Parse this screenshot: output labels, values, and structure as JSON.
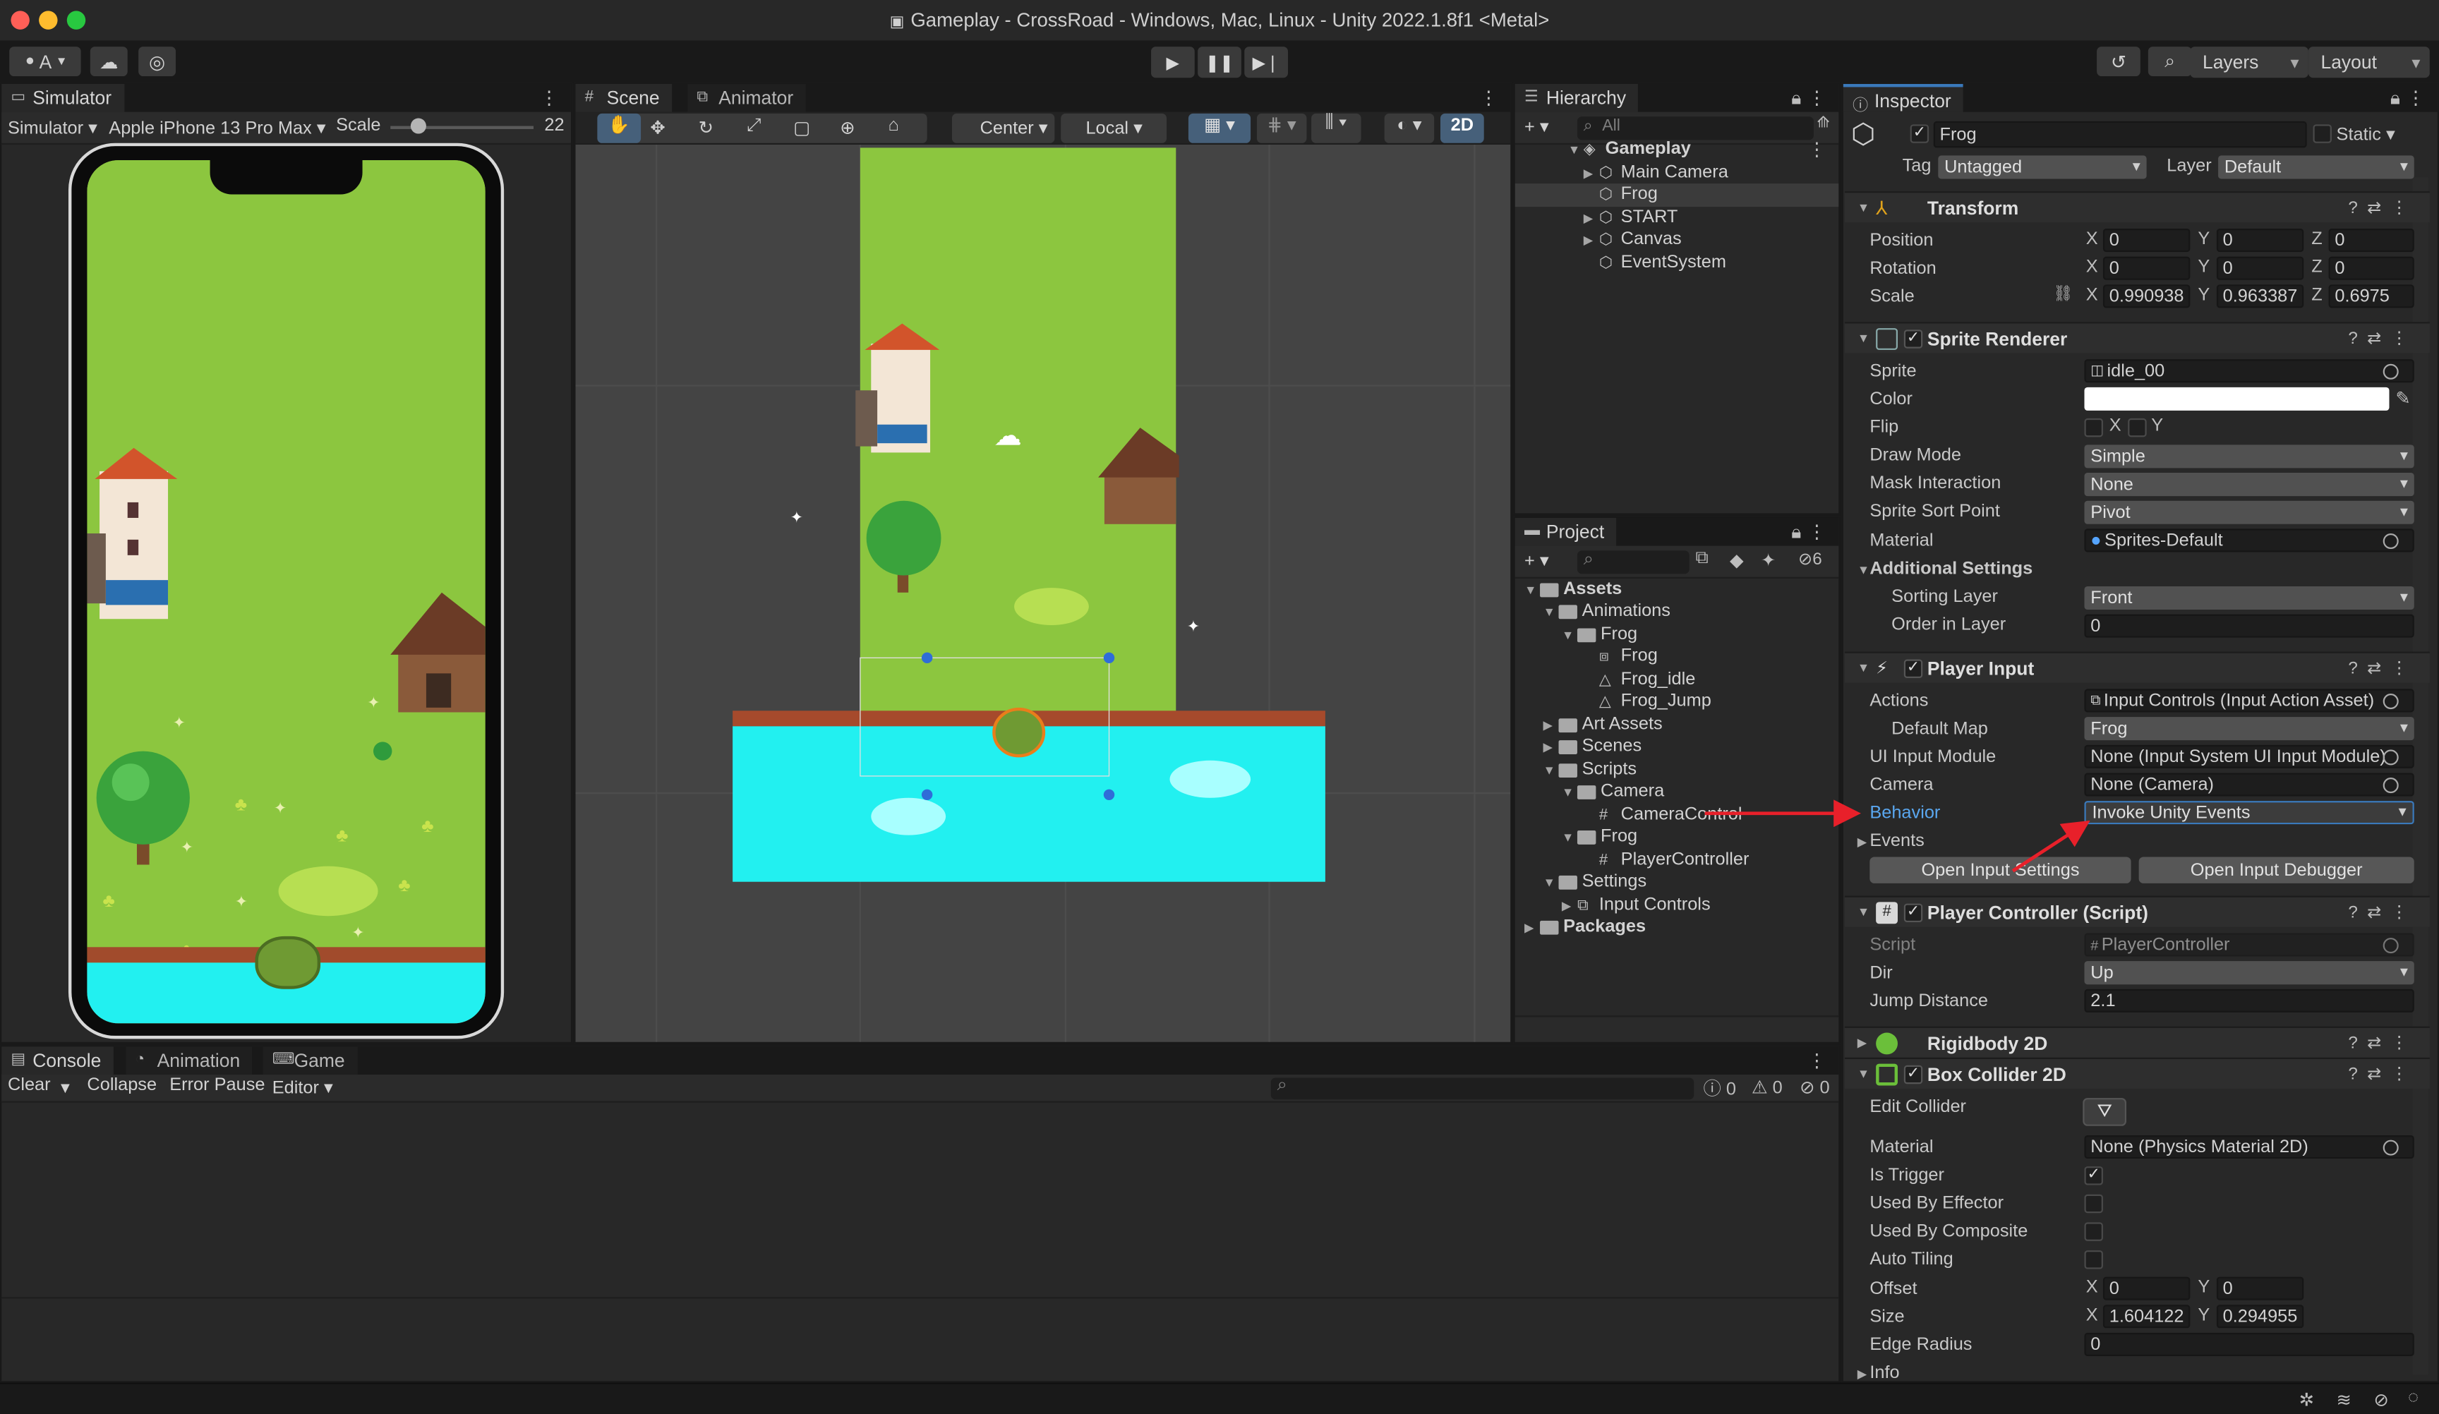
{
  "window": {
    "title": "Gameplay - CrossRoad - Windows, Mac, Linux - Unity 2022.1.8f1 <Metal>"
  },
  "toolbar": {
    "account": "A",
    "layers": "Layers",
    "layout": "Layout"
  },
  "simulator": {
    "tab": "Simulator",
    "mode": "Simulator",
    "device": "Apple iPhone 13 Pro Max",
    "scale_label": "Scale",
    "scale_value": "22",
    "scale_fraction": 0.2
  },
  "scene": {
    "tab": "Scene",
    "animator_tab": "Animator",
    "pivot": "Center",
    "space": "Local",
    "mode_2d": "2D"
  },
  "hierarchy": {
    "tab": "Hierarchy",
    "search_placeholder": "All",
    "scene_name": "Gameplay",
    "items": [
      "Main Camera",
      "Frog",
      "START",
      "Canvas",
      "EventSystem"
    ]
  },
  "project": {
    "tab": "Project",
    "hidden_count": "6",
    "tree": {
      "assets": "Assets",
      "animations": "Animations",
      "frog_folder": "Frog",
      "frog_controller": "Frog",
      "frog_idle": "Frog_idle",
      "frog_jump": "Frog_Jump",
      "art_assets": "Art Assets",
      "scenes": "Scenes",
      "scripts": "Scripts",
      "camera_folder": "Camera",
      "camera_control": "CameraControl",
      "frog_scripts": "Frog",
      "player_controller": "PlayerController",
      "settings": "Settings",
      "input_controls": "Input Controls",
      "packages": "Packages"
    }
  },
  "console": {
    "tabs": [
      "Console",
      "Animation",
      "Game"
    ],
    "clear": "Clear",
    "collapse": "Collapse",
    "error_pause": "Error Pause",
    "editor": "Editor",
    "count_errors": "0",
    "count_warnings": "0",
    "count_info": "0"
  },
  "inspector": {
    "tab": "Inspector",
    "object_name": "Frog",
    "static_label": "Static",
    "tag_label": "Tag",
    "tag_value": "Untagged",
    "layer_label": "Layer",
    "layer_value": "Default",
    "transform": {
      "title": "Transform",
      "position_label": "Position",
      "position": [
        "0",
        "0",
        "0"
      ],
      "rotation_label": "Rotation",
      "rotation": [
        "0",
        "0",
        "0"
      ],
      "scale_label": "Scale",
      "scale": [
        "0.990938",
        "0.963387",
        "0.6975"
      ]
    },
    "sprite_renderer": {
      "title": "Sprite Renderer",
      "sprite_label": "Sprite",
      "sprite": "idle_00",
      "color_label": "Color",
      "color": "#ffffff",
      "flip_label": "Flip",
      "flip_x": "X",
      "flip_y": "Y",
      "draw_mode_label": "Draw Mode",
      "draw_mode": "Simple",
      "mask_label": "Mask Interaction",
      "mask": "None",
      "sort_point_label": "Sprite Sort Point",
      "sort_point": "Pivot",
      "material_label": "Material",
      "material": "Sprites-Default",
      "additional_label": "Additional Settings",
      "sorting_layer_label": "Sorting Layer",
      "sorting_layer": "Front",
      "order_label": "Order in Layer",
      "order": "0"
    },
    "player_input": {
      "title": "Player Input",
      "actions_label": "Actions",
      "actions": "Input Controls (Input Action Asset)",
      "default_map_label": "Default Map",
      "default_map": "Frog",
      "ui_module_label": "UI Input Module",
      "ui_module": "None (Input System UI Input Module)",
      "camera_label": "Camera",
      "camera": "None (Camera)",
      "behavior_label": "Behavior",
      "behavior": "Invoke Unity Events",
      "events_label": "Events",
      "open_settings": "Open Input Settings",
      "open_debugger": "Open Input Debugger"
    },
    "player_controller": {
      "title": "Player Controller (Script)",
      "script_label": "Script",
      "script": "PlayerController",
      "dir_label": "Dir",
      "dir": "Up",
      "jump_label": "Jump Distance",
      "jump": "2.1"
    },
    "rigidbody": {
      "title": "Rigidbody 2D"
    },
    "box_collider": {
      "title": "Box Collider 2D",
      "edit_label": "Edit Collider",
      "material_label": "Material",
      "material": "None (Physics Material 2D)",
      "trigger_label": "Is Trigger",
      "effector_label": "Used By Effector",
      "composite_label": "Used By Composite",
      "tiling_label": "Auto Tiling",
      "offset_label": "Offset",
      "offset": [
        "0",
        "0"
      ],
      "size_label": "Size",
      "size": [
        "1.604122",
        "0.294955"
      ],
      "radius_label": "Edge Radius",
      "radius": "0",
      "info_label": "Info"
    }
  },
  "axis_letters": {
    "x": "X",
    "y": "Y",
    "z": "Z"
  },
  "colors": {
    "accent": "#2c5d87",
    "annotation_arrow": "#e8202a",
    "grass": "#8cc63f",
    "water": "#22f0f0"
  }
}
